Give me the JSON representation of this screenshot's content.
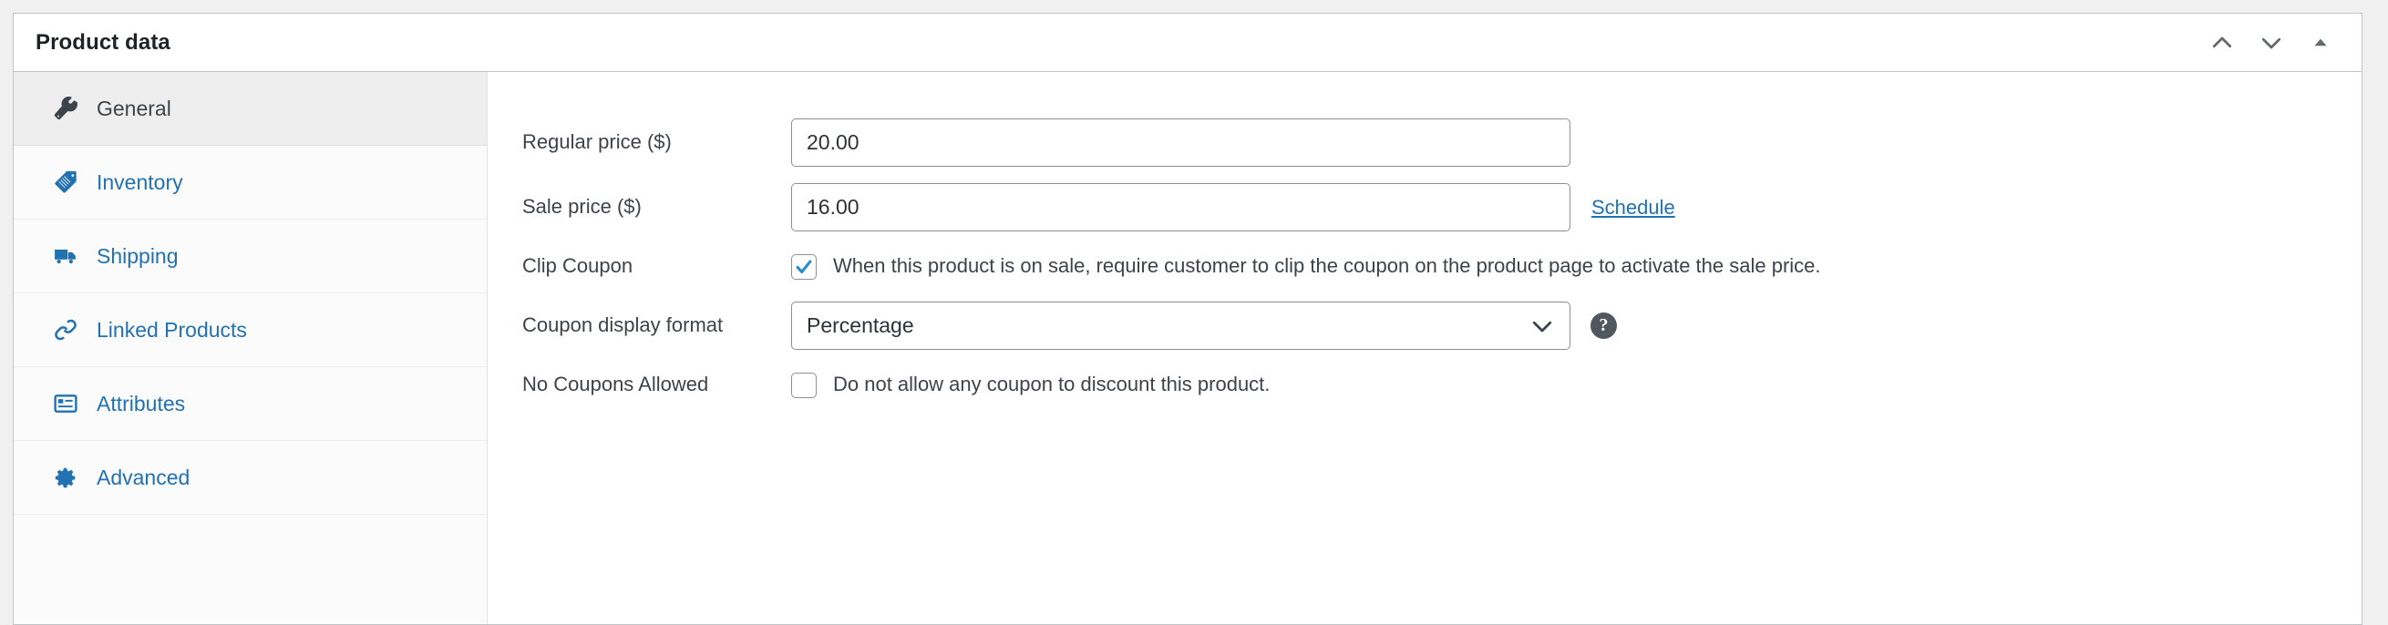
{
  "panel": {
    "title": "Product data",
    "actions": [
      {
        "name": "move-up",
        "icon": "chevron-up-icon"
      },
      {
        "name": "move-down",
        "icon": "chevron-down-icon"
      },
      {
        "name": "toggle-panel",
        "icon": "triangle-up-icon"
      }
    ]
  },
  "tabs": [
    {
      "label": "General",
      "icon": "wrench-icon",
      "active": true
    },
    {
      "label": "Inventory",
      "icon": "tag-icon",
      "active": false
    },
    {
      "label": "Shipping",
      "icon": "truck-icon",
      "active": false
    },
    {
      "label": "Linked Products",
      "icon": "link-icon",
      "active": false
    },
    {
      "label": "Attributes",
      "icon": "list-icon",
      "active": false
    },
    {
      "label": "Advanced",
      "icon": "gear-icon",
      "active": false
    }
  ],
  "form": {
    "regular_price": {
      "label": "Regular price ($)",
      "value": "20.00",
      "placeholder": ""
    },
    "sale_price": {
      "label": "Sale price ($)",
      "value": "16.00",
      "placeholder": "",
      "schedule_link": "Schedule"
    },
    "clip_coupon": {
      "label": "Clip Coupon",
      "checkbox_text": "When this product is on sale, require customer to clip the coupon on the product page to activate the sale price.",
      "checked": true
    },
    "coupon_display_format": {
      "label": "Coupon display format",
      "value": "Percentage",
      "options": [
        "Percentage"
      ],
      "help": "?"
    },
    "no_coupons_allowed": {
      "label": "No Coupons Allowed",
      "checkbox_text": "Do not allow any coupon to discount this product.",
      "checked": false
    }
  },
  "colors": {
    "link": "#2271b1",
    "text": "#3c434a",
    "title": "#1d2327",
    "panel_border": "#c3c4c7",
    "input_border": "#8c8f94",
    "active_tab_bg": "#eeeeee",
    "page_bg": "#f0f0f1",
    "help_bg": "#50575e"
  }
}
